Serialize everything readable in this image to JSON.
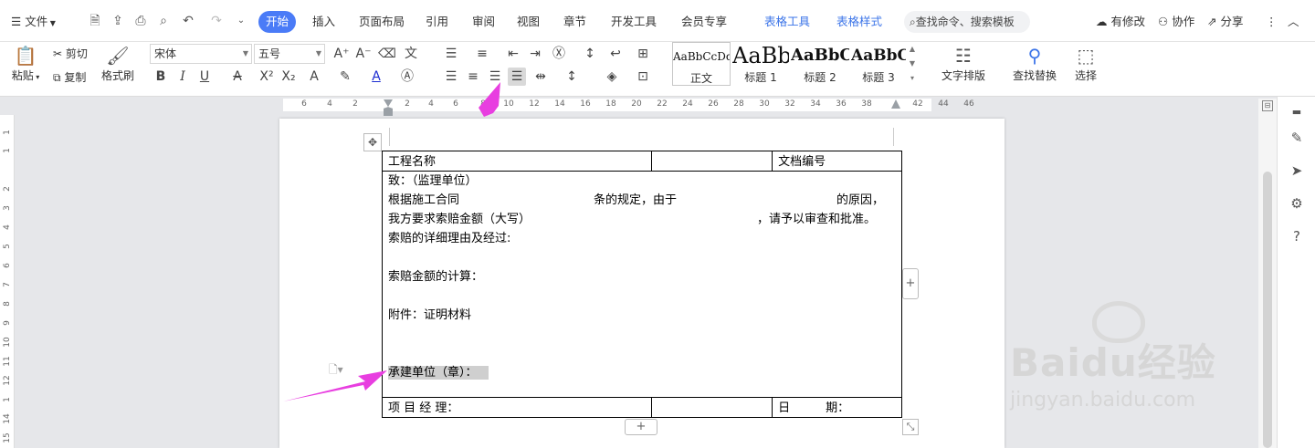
{
  "topbar": {
    "file_menu": "文件",
    "tabs": [
      {
        "label": "开始",
        "active": true
      },
      {
        "label": "插入"
      },
      {
        "label": "页面布局"
      },
      {
        "label": "引用"
      },
      {
        "label": "审阅"
      },
      {
        "label": "视图"
      },
      {
        "label": "章节"
      },
      {
        "label": "开发工具"
      },
      {
        "label": "会员专享"
      },
      {
        "label": "表格工具",
        "blue": true
      },
      {
        "label": "表格样式",
        "blue": true
      }
    ],
    "search_placeholder": "查找命令、搜索模板",
    "modified": "有修改",
    "collab": "协作",
    "share": "分享",
    "accent": "#4a7bf7"
  },
  "ribbon": {
    "paste": "粘贴",
    "cut": "剪切",
    "copy": "复制",
    "format_painter": "格式刷",
    "font_name": "宋体",
    "font_size": "五号",
    "styles": [
      {
        "preview": "AaBbCcDd",
        "label": "正文"
      },
      {
        "preview": "AaBb",
        "label": "标题 1"
      },
      {
        "preview": "AaBbC",
        "label": "标题 2"
      },
      {
        "preview": "AaBbC",
        "label": "标题 3"
      }
    ],
    "text_layout": "文字排版",
    "find_replace": "查找替换",
    "select": "选择"
  },
  "ruler": {
    "h_numbers": [
      "6",
      "4",
      "2",
      "2",
      "4",
      "6",
      "8",
      "10",
      "12",
      "14",
      "16",
      "18",
      "20",
      "22",
      "24",
      "26",
      "28",
      "30",
      "32",
      "34",
      "36",
      "38",
      "42",
      "44",
      "46"
    ],
    "v_numbers": [
      "1",
      "1",
      "2",
      "3",
      "4",
      "5",
      "6",
      "7",
      "8",
      "9",
      "10",
      "11",
      "12",
      "1",
      "14",
      "15"
    ]
  },
  "doc": {
    "row1": {
      "c1": "工程名称",
      "c2": "",
      "c3": "文档编号",
      "c4": ""
    },
    "to_line": "致：（监理单位）",
    "line2a": "根据施工合同",
    "line2b": "条的规定，由于",
    "line2c": "的原因，",
    "line3a": "我方要求索赔金额（大写）",
    "line3b": "，请予以审查和批准。",
    "line4": "索赔的详细理由及经过:",
    "line5": "索赔金额的计算：",
    "line6": "附件：证明材料",
    "line7": "承建单位（章）：",
    "row_last": {
      "c1": "项 目 经 理：",
      "c2": "",
      "c3": "日　　　期：",
      "c4": ""
    }
  },
  "watermark": {
    "brand": "Baidu经验",
    "url": "jingyan.baidu.com"
  },
  "annotation_color": "#e83ee0"
}
